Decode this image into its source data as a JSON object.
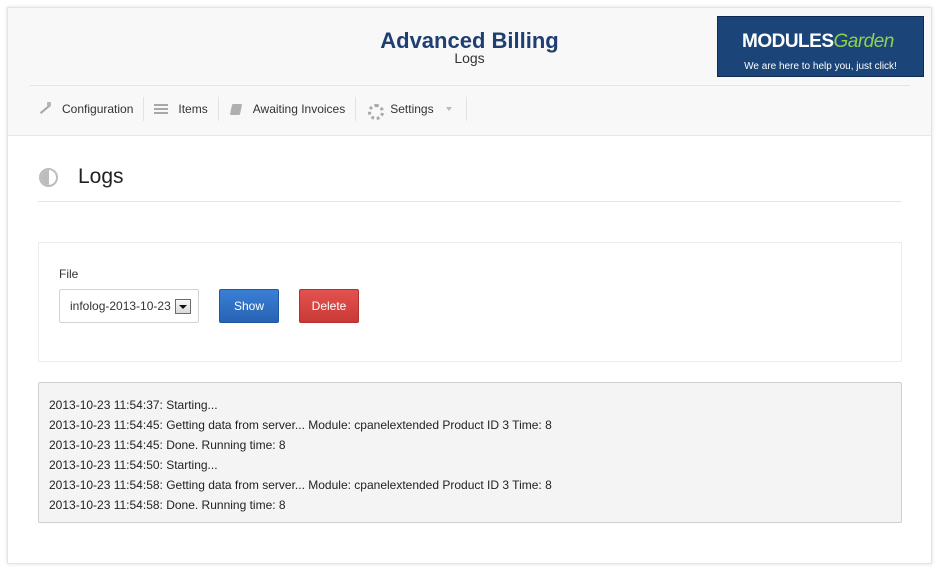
{
  "header": {
    "title": "Advanced Billing",
    "subtitle": "Logs",
    "logo": {
      "brand_modules": "MODULES",
      "brand_garden": "Garden",
      "tagline": "We are here to help you, just click!"
    }
  },
  "nav": {
    "items": [
      {
        "label": "Configuration",
        "icon": "wand-icon"
      },
      {
        "label": "Items",
        "icon": "list-icon"
      },
      {
        "label": "Awaiting Invoices",
        "icon": "book-icon"
      },
      {
        "label": "Settings",
        "icon": "gear-icon"
      }
    ]
  },
  "page": {
    "title": "Logs"
  },
  "form": {
    "file_label": "File",
    "file_value": "infolog-2013-10-23",
    "show_label": "Show",
    "delete_label": "Delete"
  },
  "log": {
    "lines": [
      "2013-10-23 11:54:37: Starting...",
      "2013-10-23 11:54:45: Getting data from server... Module: cpanelextended Product ID 3 Time: 8",
      "2013-10-23 11:54:45: Done. Running time: 8",
      "2013-10-23 11:54:50: Starting...",
      "2013-10-23 11:54:58: Getting data from server... Module: cpanelextended Product ID 3 Time: 8",
      "2013-10-23 11:54:58: Done. Running time: 8"
    ]
  },
  "colors": {
    "title": "#1f3f73",
    "show_button": "#2d6cc0",
    "delete_button": "#d64542",
    "logo_bg": "#1b4479",
    "logo_accent": "#8fd14f"
  }
}
